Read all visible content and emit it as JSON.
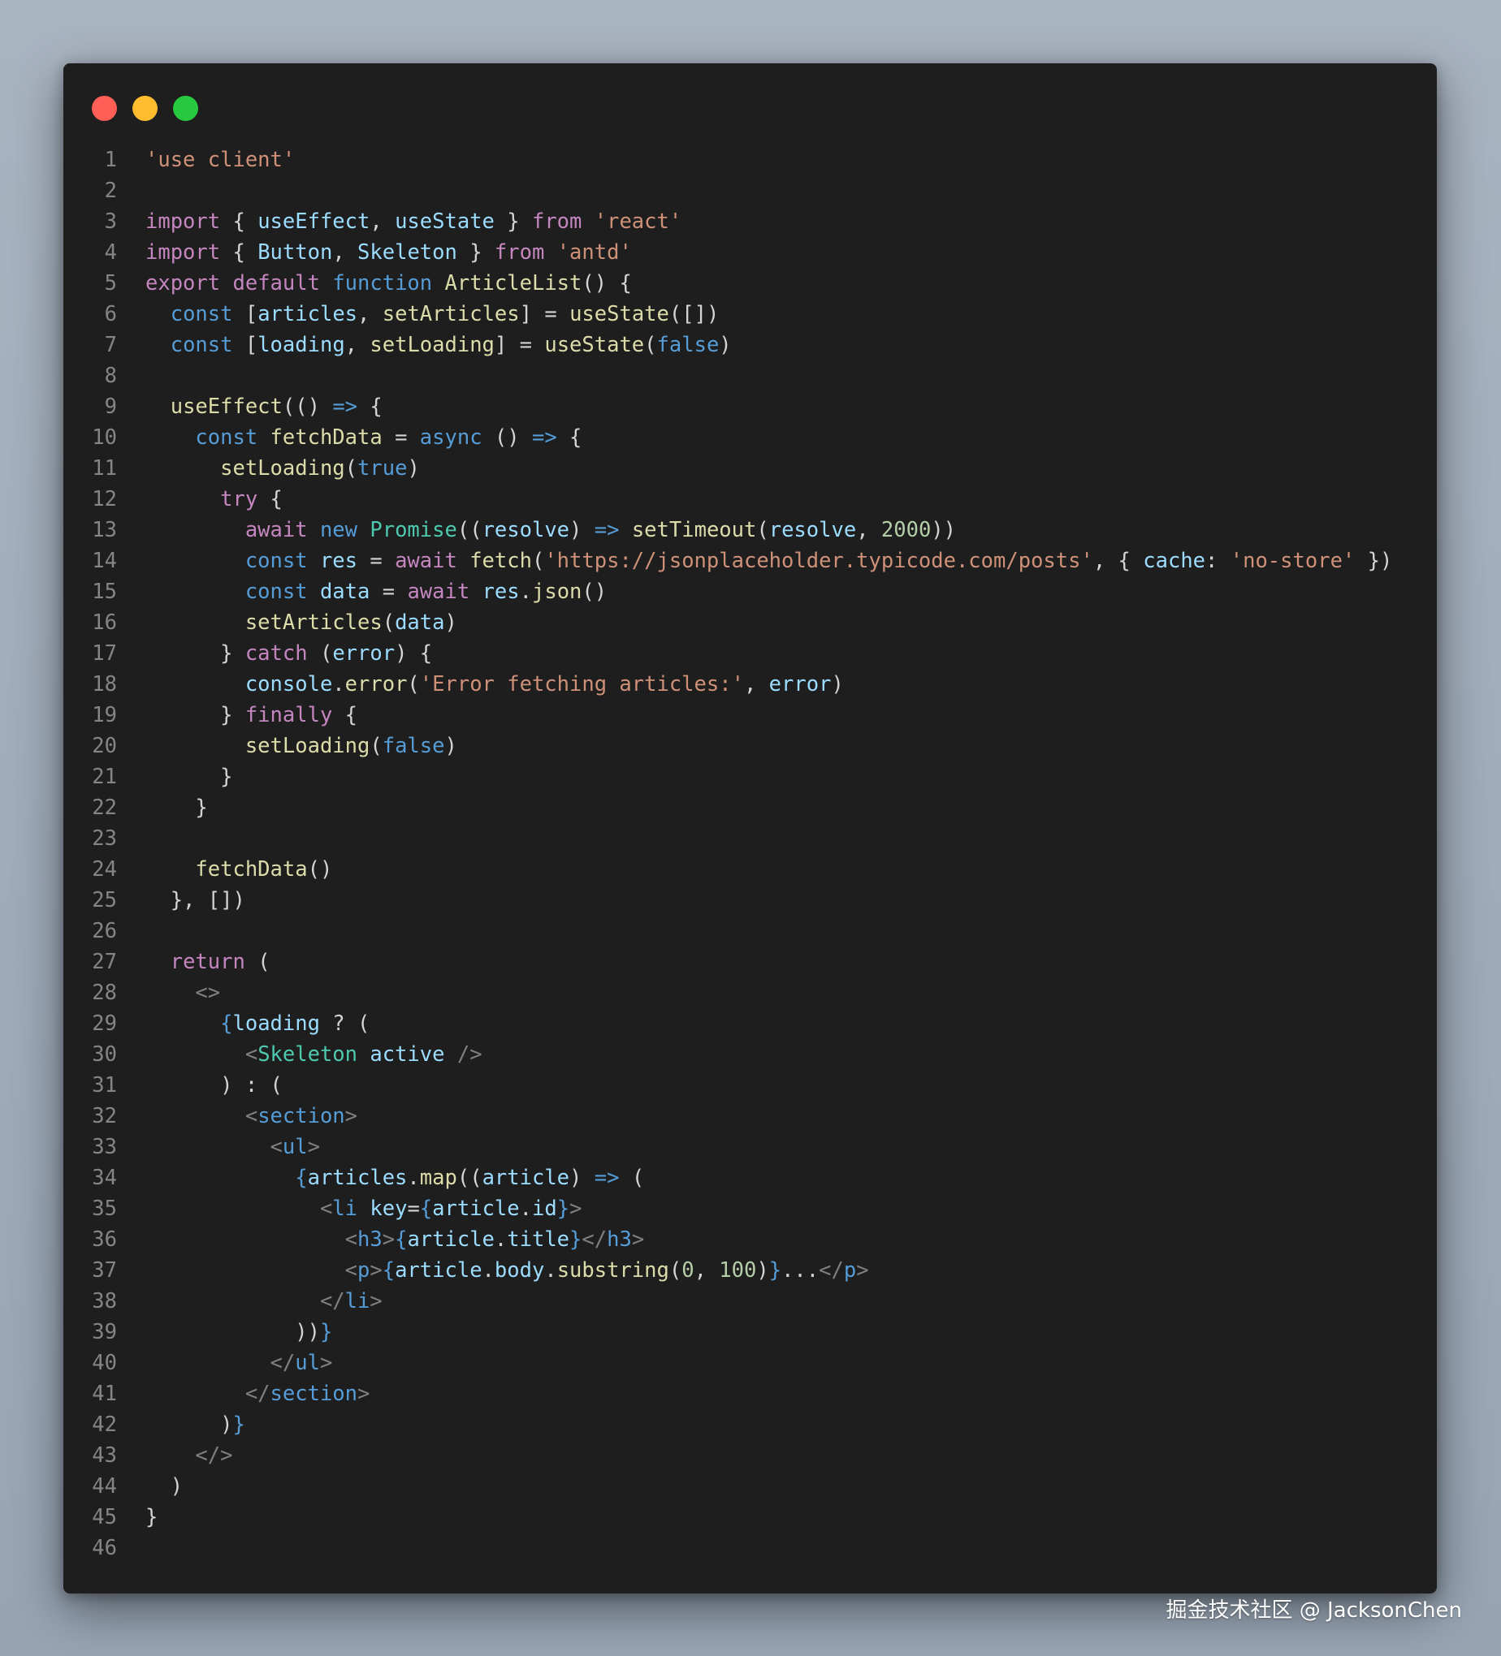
{
  "window": {
    "controls": [
      {
        "name": "close",
        "color": "#ff5f56"
      },
      {
        "name": "minimize",
        "color": "#ffbd2e"
      },
      {
        "name": "zoom",
        "color": "#27c93f"
      }
    ]
  },
  "theme": {
    "keyword": "#c586c0",
    "storage": "#569cd6",
    "string": "#ce9178",
    "function": "#dcdcaa",
    "variable": "#9cdcfe",
    "type": "#4ec9b0",
    "number": "#b5cea8",
    "plain": "#d4d4d4",
    "tag": "#808080",
    "line_number": "#858585"
  },
  "code": {
    "lines": [
      [
        [
          "'use client'",
          "string"
        ]
      ],
      [],
      [
        [
          "import",
          "keyword"
        ],
        [
          " { ",
          "plain"
        ],
        [
          "useEffect",
          "variable"
        ],
        [
          ", ",
          "plain"
        ],
        [
          "useState",
          "variable"
        ],
        [
          " } ",
          "plain"
        ],
        [
          "from",
          "keyword"
        ],
        [
          " ",
          "plain"
        ],
        [
          "'react'",
          "string"
        ]
      ],
      [
        [
          "import",
          "keyword"
        ],
        [
          " { ",
          "plain"
        ],
        [
          "Button",
          "variable"
        ],
        [
          ", ",
          "plain"
        ],
        [
          "Skeleton",
          "variable"
        ],
        [
          " } ",
          "plain"
        ],
        [
          "from",
          "keyword"
        ],
        [
          " ",
          "plain"
        ],
        [
          "'antd'",
          "string"
        ]
      ],
      [
        [
          "export",
          "keyword"
        ],
        [
          " ",
          "plain"
        ],
        [
          "default",
          "keyword"
        ],
        [
          " ",
          "plain"
        ],
        [
          "function",
          "storage"
        ],
        [
          " ",
          "plain"
        ],
        [
          "ArticleList",
          "function"
        ],
        [
          "() {",
          "plain"
        ]
      ],
      [
        [
          "  ",
          "plain"
        ],
        [
          "const",
          "storage"
        ],
        [
          " [",
          "plain"
        ],
        [
          "articles",
          "variable"
        ],
        [
          ", ",
          "plain"
        ],
        [
          "setArticles",
          "function"
        ],
        [
          "] = ",
          "plain"
        ],
        [
          "useState",
          "function"
        ],
        [
          "([])",
          "plain"
        ]
      ],
      [
        [
          "  ",
          "plain"
        ],
        [
          "const",
          "storage"
        ],
        [
          " [",
          "plain"
        ],
        [
          "loading",
          "variable"
        ],
        [
          ", ",
          "plain"
        ],
        [
          "setLoading",
          "function"
        ],
        [
          "] = ",
          "plain"
        ],
        [
          "useState",
          "function"
        ],
        [
          "(",
          "plain"
        ],
        [
          "false",
          "storage"
        ],
        [
          ")",
          "plain"
        ]
      ],
      [],
      [
        [
          "  ",
          "plain"
        ],
        [
          "useEffect",
          "function"
        ],
        [
          "(() ",
          "plain"
        ],
        [
          "=>",
          "storage"
        ],
        [
          " {",
          "plain"
        ]
      ],
      [
        [
          "    ",
          "plain"
        ],
        [
          "const",
          "storage"
        ],
        [
          " ",
          "plain"
        ],
        [
          "fetchData",
          "function"
        ],
        [
          " = ",
          "plain"
        ],
        [
          "async",
          "storage"
        ],
        [
          " () ",
          "plain"
        ],
        [
          "=>",
          "storage"
        ],
        [
          " {",
          "plain"
        ]
      ],
      [
        [
          "      ",
          "plain"
        ],
        [
          "setLoading",
          "function"
        ],
        [
          "(",
          "plain"
        ],
        [
          "true",
          "storage"
        ],
        [
          ")",
          "plain"
        ]
      ],
      [
        [
          "      ",
          "plain"
        ],
        [
          "try",
          "keyword"
        ],
        [
          " {",
          "plain"
        ]
      ],
      [
        [
          "        ",
          "plain"
        ],
        [
          "await",
          "keyword"
        ],
        [
          " ",
          "plain"
        ],
        [
          "new",
          "storage"
        ],
        [
          " ",
          "plain"
        ],
        [
          "Promise",
          "type"
        ],
        [
          "((",
          "plain"
        ],
        [
          "resolve",
          "variable"
        ],
        [
          ") ",
          "plain"
        ],
        [
          "=>",
          "storage"
        ],
        [
          " ",
          "plain"
        ],
        [
          "setTimeout",
          "function"
        ],
        [
          "(",
          "plain"
        ],
        [
          "resolve",
          "variable"
        ],
        [
          ", ",
          "plain"
        ],
        [
          "2000",
          "number"
        ],
        [
          "))",
          "plain"
        ]
      ],
      [
        [
          "        ",
          "plain"
        ],
        [
          "const",
          "storage"
        ],
        [
          " ",
          "plain"
        ],
        [
          "res",
          "variable"
        ],
        [
          " = ",
          "plain"
        ],
        [
          "await",
          "keyword"
        ],
        [
          " ",
          "plain"
        ],
        [
          "fetch",
          "function"
        ],
        [
          "(",
          "plain"
        ],
        [
          "'https://jsonplaceholder.typicode.com/posts'",
          "string"
        ],
        [
          ", { ",
          "plain"
        ],
        [
          "cache",
          "variable"
        ],
        [
          ": ",
          "plain"
        ],
        [
          "'no-store'",
          "string"
        ],
        [
          " })",
          "plain"
        ]
      ],
      [
        [
          "        ",
          "plain"
        ],
        [
          "const",
          "storage"
        ],
        [
          " ",
          "plain"
        ],
        [
          "data",
          "variable"
        ],
        [
          " = ",
          "plain"
        ],
        [
          "await",
          "keyword"
        ],
        [
          " ",
          "plain"
        ],
        [
          "res",
          "variable"
        ],
        [
          ".",
          "plain"
        ],
        [
          "json",
          "function"
        ],
        [
          "()",
          "plain"
        ]
      ],
      [
        [
          "        ",
          "plain"
        ],
        [
          "setArticles",
          "function"
        ],
        [
          "(",
          "plain"
        ],
        [
          "data",
          "variable"
        ],
        [
          ")",
          "plain"
        ]
      ],
      [
        [
          "      } ",
          "plain"
        ],
        [
          "catch",
          "keyword"
        ],
        [
          " (",
          "plain"
        ],
        [
          "error",
          "variable"
        ],
        [
          ") {",
          "plain"
        ]
      ],
      [
        [
          "        ",
          "plain"
        ],
        [
          "console",
          "variable"
        ],
        [
          ".",
          "plain"
        ],
        [
          "error",
          "function"
        ],
        [
          "(",
          "plain"
        ],
        [
          "'Error fetching articles:'",
          "string"
        ],
        [
          ", ",
          "plain"
        ],
        [
          "error",
          "variable"
        ],
        [
          ")",
          "plain"
        ]
      ],
      [
        [
          "      } ",
          "plain"
        ],
        [
          "finally",
          "keyword"
        ],
        [
          " {",
          "plain"
        ]
      ],
      [
        [
          "        ",
          "plain"
        ],
        [
          "setLoading",
          "function"
        ],
        [
          "(",
          "plain"
        ],
        [
          "false",
          "storage"
        ],
        [
          ")",
          "plain"
        ]
      ],
      [
        [
          "      }",
          "plain"
        ]
      ],
      [
        [
          "    }",
          "plain"
        ]
      ],
      [],
      [
        [
          "    ",
          "plain"
        ],
        [
          "fetchData",
          "function"
        ],
        [
          "()",
          "plain"
        ]
      ],
      [
        [
          "  }, [])",
          "plain"
        ]
      ],
      [],
      [
        [
          "  ",
          "plain"
        ],
        [
          "return",
          "keyword"
        ],
        [
          " (",
          "plain"
        ]
      ],
      [
        [
          "    ",
          "plain"
        ],
        [
          "<>",
          "tag"
        ]
      ],
      [
        [
          "      ",
          "plain"
        ],
        [
          "{",
          "storage"
        ],
        [
          "loading",
          "variable"
        ],
        [
          " ? (",
          "plain"
        ]
      ],
      [
        [
          "        ",
          "plain"
        ],
        [
          "<",
          "tag"
        ],
        [
          "Skeleton",
          "type"
        ],
        [
          " ",
          "plain"
        ],
        [
          "active",
          "variable"
        ],
        [
          " />",
          "tag"
        ]
      ],
      [
        [
          "      ) : (",
          "plain"
        ]
      ],
      [
        [
          "        ",
          "plain"
        ],
        [
          "<",
          "tag"
        ],
        [
          "section",
          "storage"
        ],
        [
          ">",
          "tag"
        ]
      ],
      [
        [
          "          ",
          "plain"
        ],
        [
          "<",
          "tag"
        ],
        [
          "ul",
          "storage"
        ],
        [
          ">",
          "tag"
        ]
      ],
      [
        [
          "            ",
          "plain"
        ],
        [
          "{",
          "storage"
        ],
        [
          "articles",
          "variable"
        ],
        [
          ".",
          "plain"
        ],
        [
          "map",
          "function"
        ],
        [
          "((",
          "plain"
        ],
        [
          "article",
          "variable"
        ],
        [
          ") ",
          "plain"
        ],
        [
          "=>",
          "storage"
        ],
        [
          " (",
          "plain"
        ]
      ],
      [
        [
          "              ",
          "plain"
        ],
        [
          "<",
          "tag"
        ],
        [
          "li",
          "storage"
        ],
        [
          " ",
          "plain"
        ],
        [
          "key",
          "variable"
        ],
        [
          "=",
          "plain"
        ],
        [
          "{",
          "storage"
        ],
        [
          "article",
          "variable"
        ],
        [
          ".",
          "plain"
        ],
        [
          "id",
          "variable"
        ],
        [
          "}",
          "storage"
        ],
        [
          ">",
          "tag"
        ]
      ],
      [
        [
          "                ",
          "plain"
        ],
        [
          "<",
          "tag"
        ],
        [
          "h3",
          "storage"
        ],
        [
          ">",
          "tag"
        ],
        [
          "{",
          "storage"
        ],
        [
          "article",
          "variable"
        ],
        [
          ".",
          "plain"
        ],
        [
          "title",
          "variable"
        ],
        [
          "}",
          "storage"
        ],
        [
          "</",
          "tag"
        ],
        [
          "h3",
          "storage"
        ],
        [
          ">",
          "tag"
        ]
      ],
      [
        [
          "                ",
          "plain"
        ],
        [
          "<",
          "tag"
        ],
        [
          "p",
          "storage"
        ],
        [
          ">",
          "tag"
        ],
        [
          "{",
          "storage"
        ],
        [
          "article",
          "variable"
        ],
        [
          ".",
          "plain"
        ],
        [
          "body",
          "variable"
        ],
        [
          ".",
          "plain"
        ],
        [
          "substring",
          "function"
        ],
        [
          "(",
          "plain"
        ],
        [
          "0",
          "number"
        ],
        [
          ", ",
          "plain"
        ],
        [
          "100",
          "number"
        ],
        [
          ")",
          "plain"
        ],
        [
          "}",
          "storage"
        ],
        [
          "...",
          "plain"
        ],
        [
          "</",
          "tag"
        ],
        [
          "p",
          "storage"
        ],
        [
          ">",
          "tag"
        ]
      ],
      [
        [
          "              ",
          "plain"
        ],
        [
          "</",
          "tag"
        ],
        [
          "li",
          "storage"
        ],
        [
          ">",
          "tag"
        ]
      ],
      [
        [
          "            ))",
          "plain"
        ],
        [
          "}",
          "storage"
        ]
      ],
      [
        [
          "          ",
          "plain"
        ],
        [
          "</",
          "tag"
        ],
        [
          "ul",
          "storage"
        ],
        [
          ">",
          "tag"
        ]
      ],
      [
        [
          "        ",
          "plain"
        ],
        [
          "</",
          "tag"
        ],
        [
          "section",
          "storage"
        ],
        [
          ">",
          "tag"
        ]
      ],
      [
        [
          "      )",
          "plain"
        ],
        [
          "}",
          "storage"
        ]
      ],
      [
        [
          "    ",
          "plain"
        ],
        [
          "</>",
          "tag"
        ]
      ],
      [
        [
          "  )",
          "plain"
        ]
      ],
      [
        [
          "}",
          "plain"
        ]
      ],
      []
    ]
  },
  "watermark": "掘金技术社区 @ JacksonChen"
}
